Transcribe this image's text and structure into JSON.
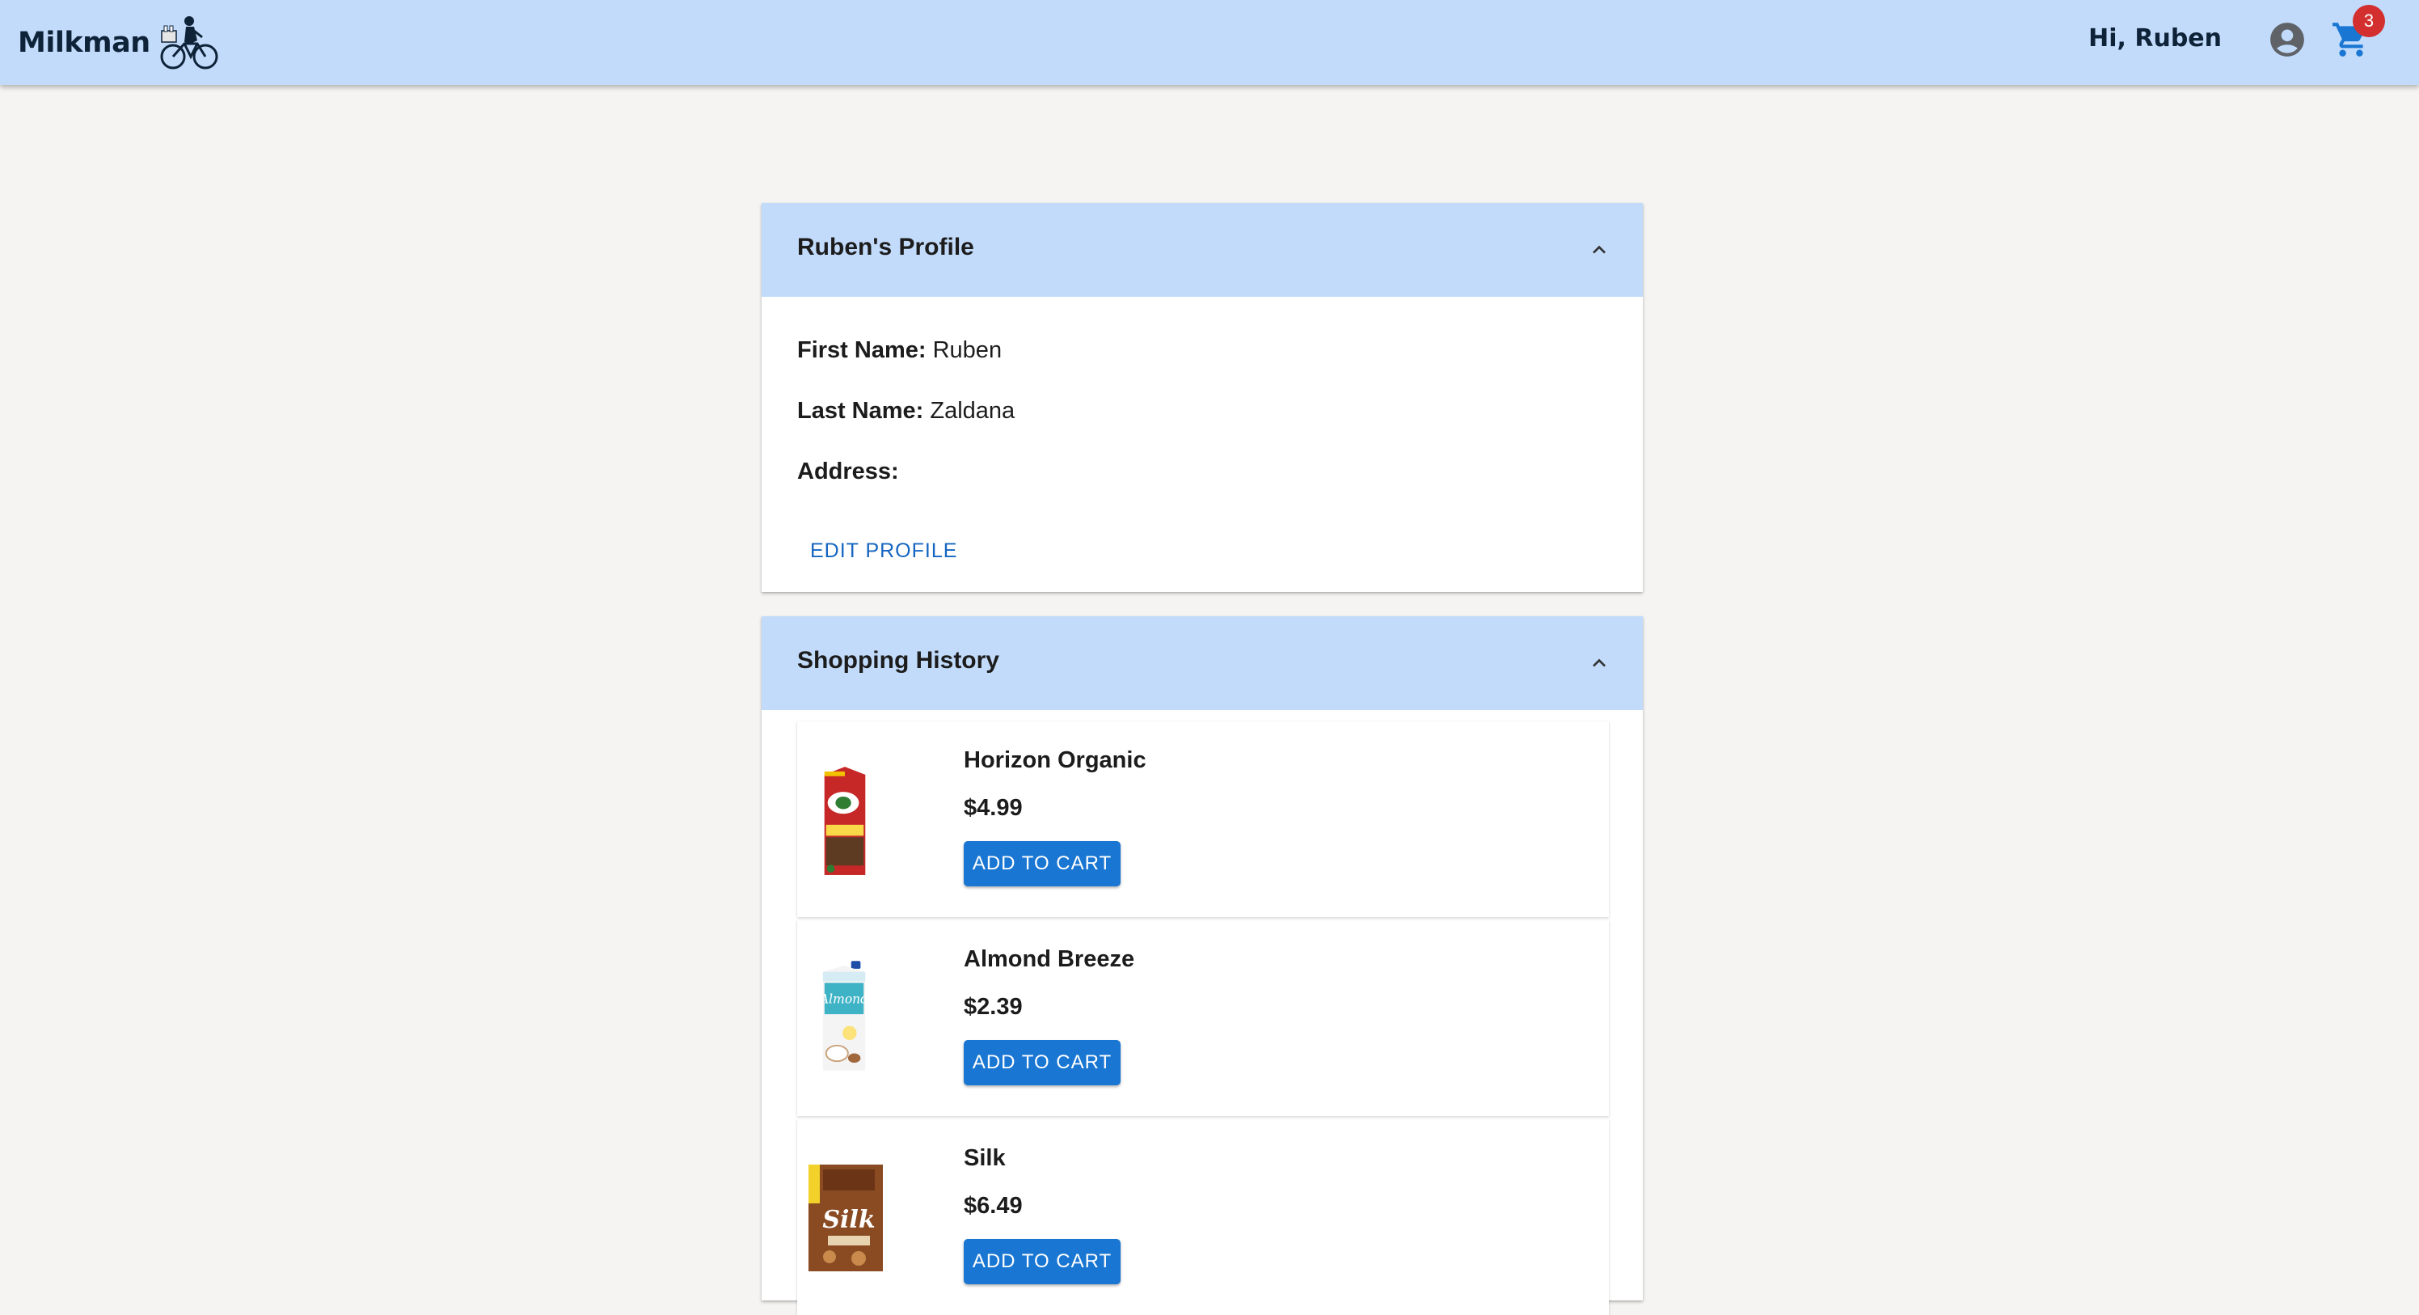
{
  "header": {
    "brand_name": "Milkman",
    "greeting": "Hi, Ruben",
    "cart_count": "3",
    "bg_color": "#c2dbfb",
    "icons": [
      "delivery-bike-icon",
      "account-circle-icon",
      "shopping-cart-icon"
    ]
  },
  "profile": {
    "title": "Ruben's Profile",
    "first_name_label": "First Name:",
    "first_name": "Ruben",
    "last_name_label": "Last Name:",
    "last_name": "Zaldana",
    "address_label": "Address:",
    "address": "",
    "edit_label": "EDIT PROFILE"
  },
  "history": {
    "title": "Shopping History",
    "items": [
      {
        "name": "Horizon Organic",
        "price": "$4.99",
        "button": "ADD TO CART",
        "image": "milk-carton-image"
      },
      {
        "name": "Almond Breeze",
        "price": "$2.39",
        "button": "ADD TO CART",
        "image": "almond-milk-carton-image"
      },
      {
        "name": "Silk",
        "price": "$6.49",
        "button": "ADD TO CART",
        "image": "silk-package-image"
      }
    ]
  },
  "colors": {
    "accent": "#1976d2",
    "badge": "#d32f2f",
    "panel_header": "#c2dbfb",
    "background": "#f5f4f2"
  }
}
